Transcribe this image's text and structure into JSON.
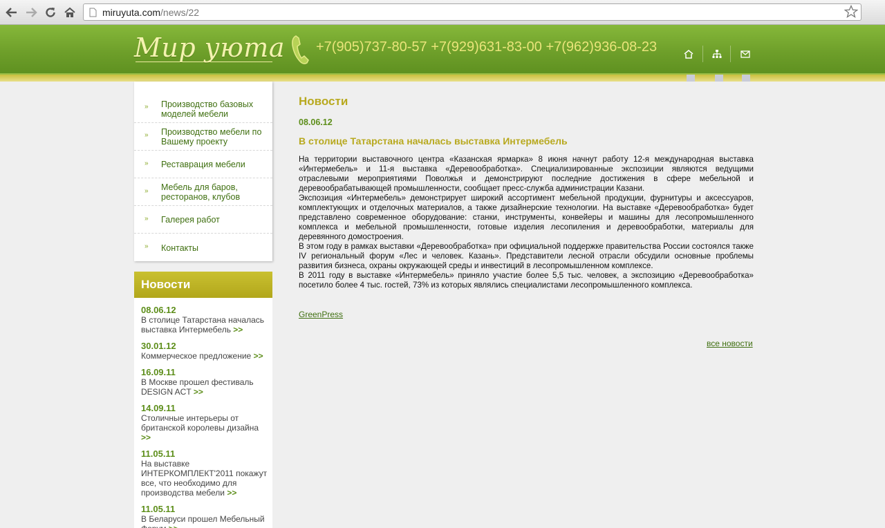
{
  "browser": {
    "url_host": "miruyuta.com",
    "url_path": "/news/22"
  },
  "header": {
    "logo": "Мир уюта",
    "phones": "+7(905)737-80-57 +7(929)631-83-00 +7(962)936-08-23",
    "icons": [
      "home-icon",
      "sitemap-icon",
      "mail-icon"
    ]
  },
  "menu": {
    "items": [
      {
        "label": "Производство базовых моделей мебели"
      },
      {
        "label": "Производство мебели по Вашему проекту"
      },
      {
        "label": "Реставрация мебели"
      },
      {
        "label": "Мебель для баров, ресторанов, клубов"
      },
      {
        "label": "Галерея работ"
      },
      {
        "label": "Контакты"
      }
    ]
  },
  "news_sidebar": {
    "title": "Новости",
    "more": ">>",
    "items": [
      {
        "date": "08.06.12",
        "text": "В столице Татарстана началась выставка Интермебель"
      },
      {
        "date": "30.01.12",
        "text": "Коммерческое предложение"
      },
      {
        "date": "16.09.11",
        "text": "В Москве прошел фестиваль DESIGN ACT"
      },
      {
        "date": "14.09.11",
        "text": "Столичные интерьеры от британской королевы дизайна"
      },
      {
        "date": "11.05.11",
        "text": "На выставке ИНТЕРКОМПЛЕКТ'2011 покажут все, что необходимо для производства мебели"
      },
      {
        "date": "11.05.11",
        "text": "В Беларуси прошел Мебельный Форум"
      }
    ]
  },
  "main": {
    "title": "Новости",
    "date": "08.06.12",
    "headline": "В столице Татарстана началась выставка Интермебель",
    "paragraphs": [
      "На территории выставочного центра «Казанская ярмарка» 8 июня начнут работу 12-я международная выставка «Интермебель» и 11-я выставка «Деревообработка». Специализированные экспозиции являются ведущими отраслевыми мероприятиями Поволжья и демонстрируют последние достижения в сфере мебельной и деревообрабатывающей промышленности, сообщает пресс-служба администрации Казани.",
      "Экспозиция «Интермебель» демонстрирует широкий ассортимент мебельной продукции, фурнитуры и аксессуаров, комплектующих и отделочных материалов, а также дизайнерские технологии. На выставке «Деревообработка» будет представлено современное оборудование: станки, инструменты, конвейеры и машины для лесопромышленного комплекса и мебельной промышленности, готовые изделия лесопиления и деревообработки, материалы для деревянного домостроения.",
      "В этом году в рамках выставки «Деревообработка» при официальной поддержке правительства России состоялся также IV региональный форум «Лес и человек. Казань». Представители лесной отрасли обсудили основные проблемы развития бизнеса, охраны окружающей среды и инвестиций в лесопромышленном комплексе.",
      "В 2011 году в выставке «Интермебель» приняло участие более 5,5 тыс. человек, а экспозицию «Деревообработка» посетило более 4 тыс. гостей, 73% из которых являлись специалистами лесопромышленного комплекса."
    ],
    "source": "GreenPress",
    "all_news": "все новости"
  }
}
